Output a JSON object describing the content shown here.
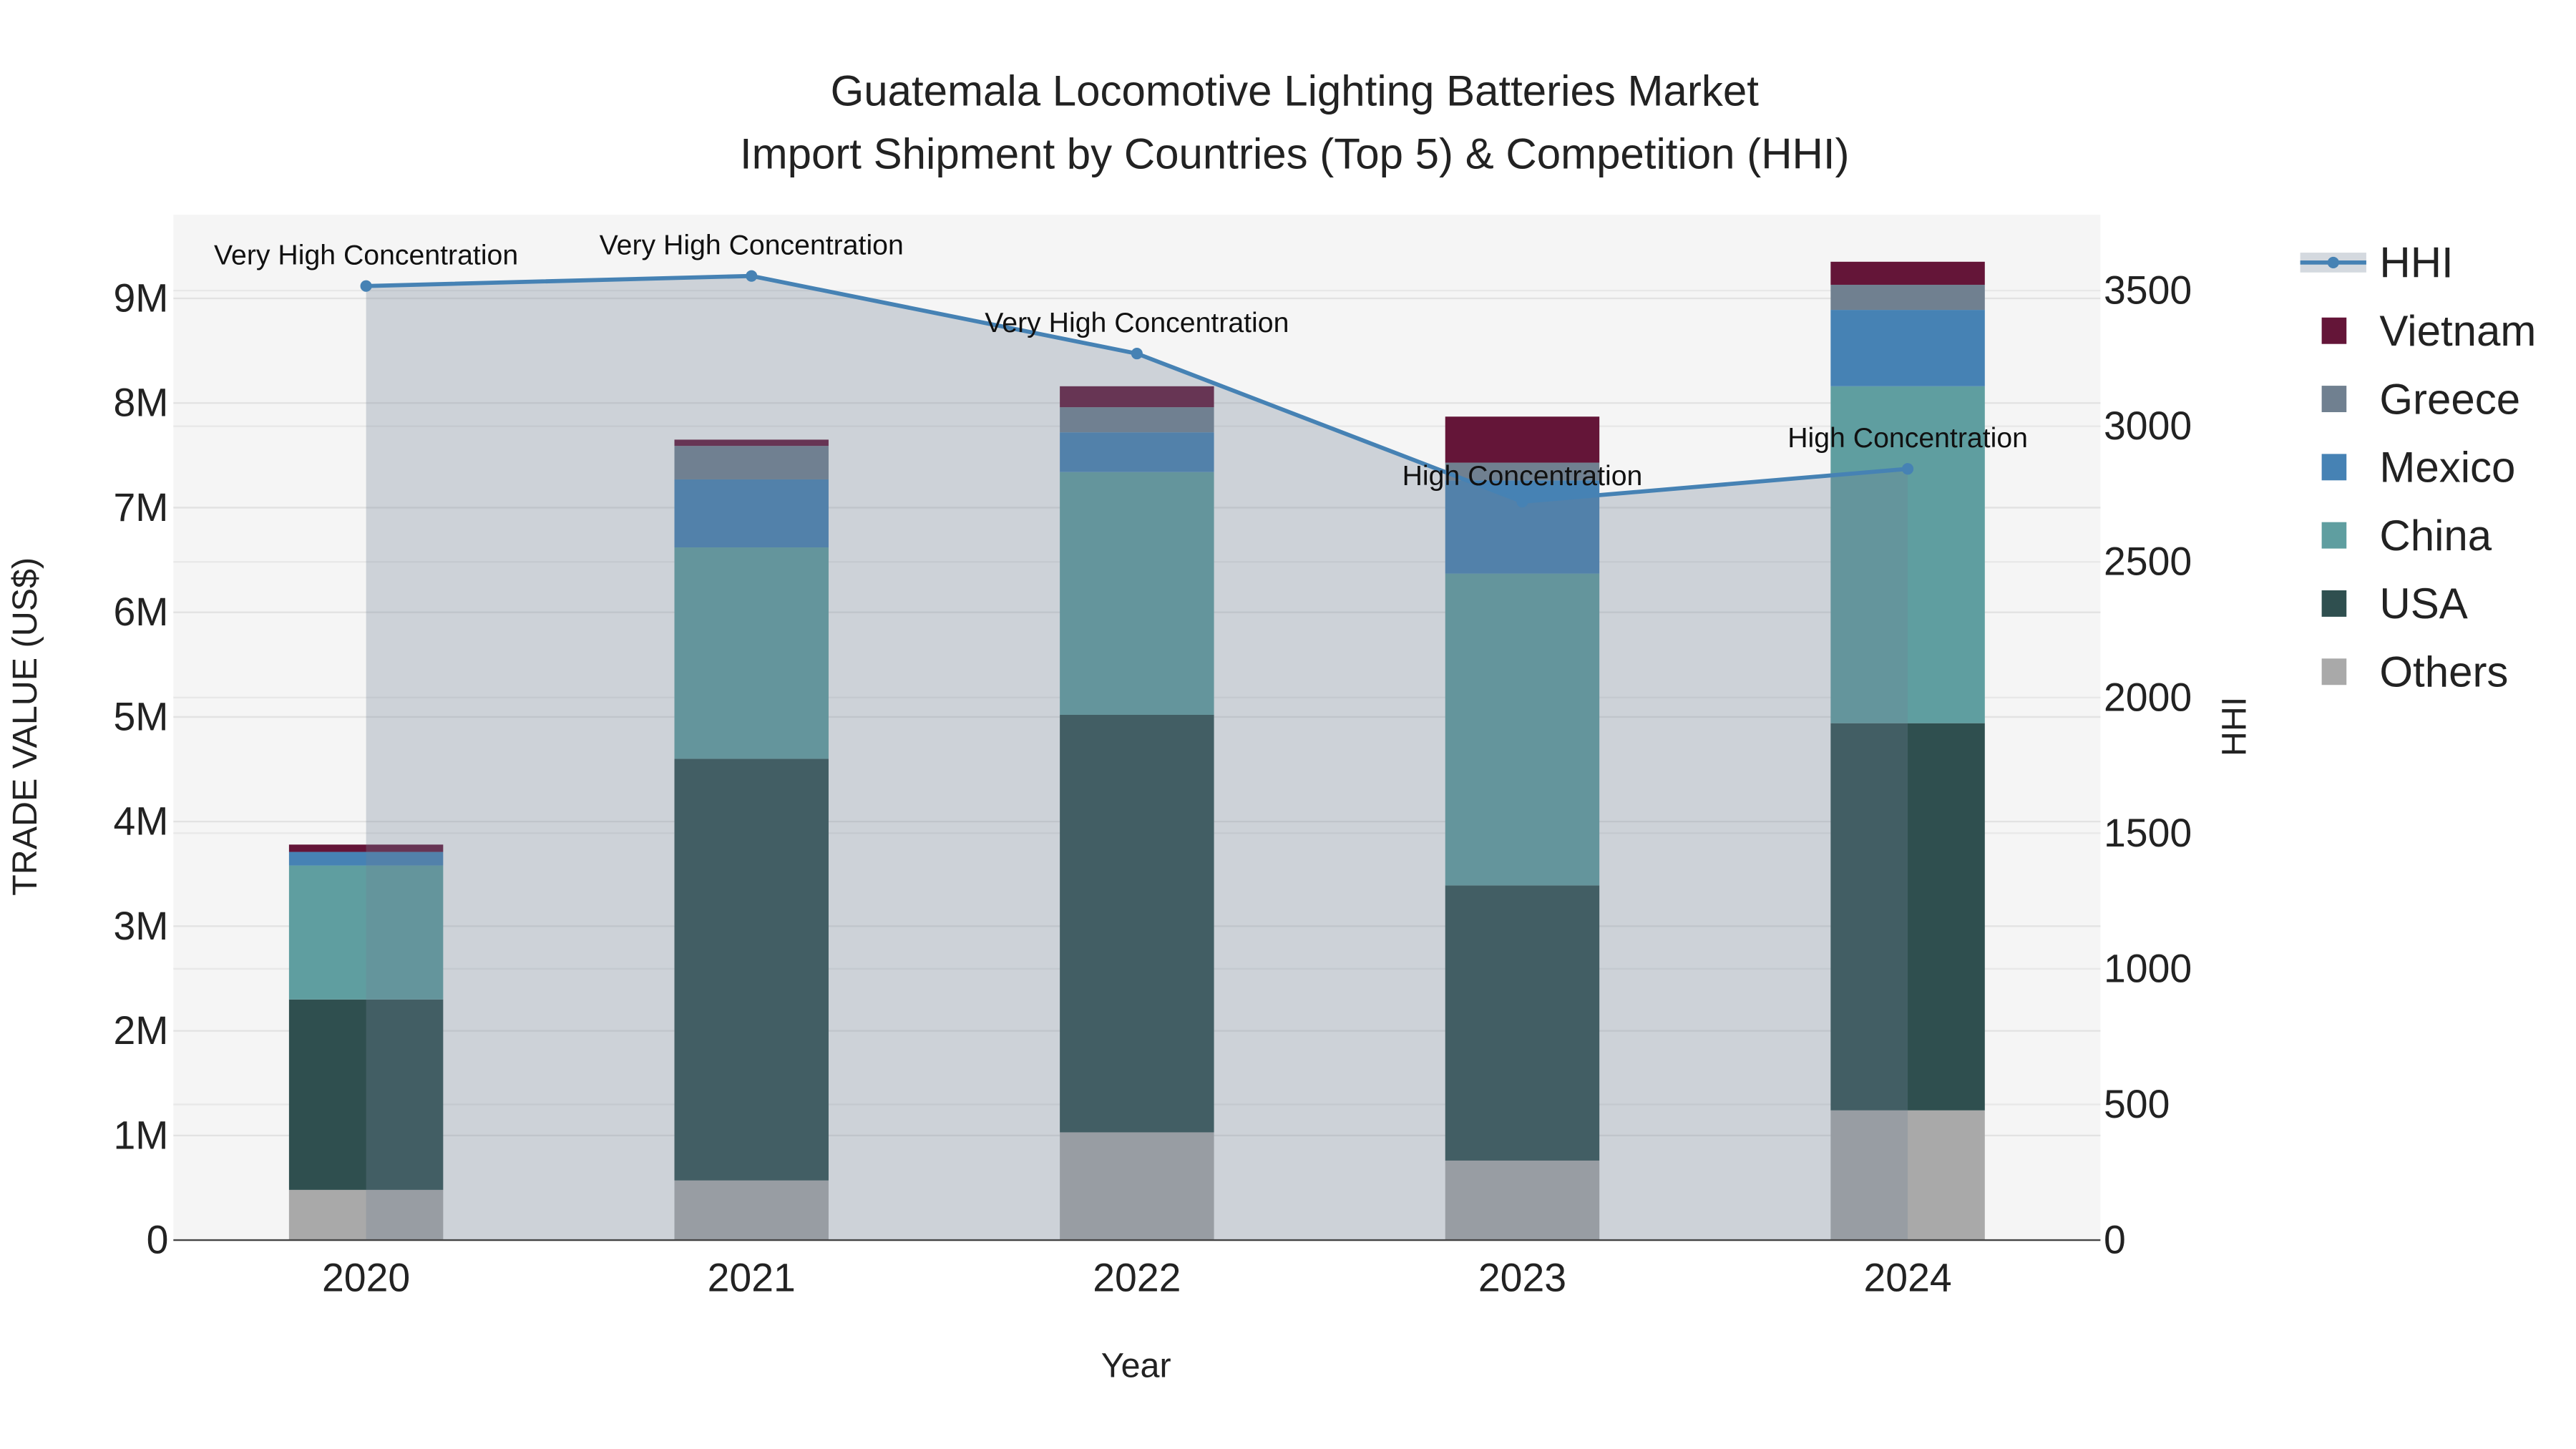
{
  "chart_data": {
    "type": "bar",
    "stacked": true,
    "title_line1": "Guatemala Locomotive Lighting Batteries Market",
    "title_line2": "Import Shipment by Countries (Top 5) & Competition (HHI)",
    "xlabel": "Year",
    "ylabel": "TRADE VALUE (US$)",
    "y2label": "HHI",
    "categories": [
      "2020",
      "2021",
      "2022",
      "2023",
      "2024"
    ],
    "ylim": [
      0,
      9800000
    ],
    "yticks": [
      0,
      1000000,
      2000000,
      3000000,
      4000000,
      5000000,
      6000000,
      7000000,
      8000000,
      9000000
    ],
    "ytick_labels": [
      "0",
      "1M",
      "2M",
      "3M",
      "4M",
      "5M",
      "6M",
      "7M",
      "8M",
      "9M"
    ],
    "y2lim": [
      0,
      3780
    ],
    "y2ticks": [
      0,
      500,
      1000,
      1500,
      2000,
      2500,
      3000,
      3500
    ],
    "y2tick_labels": [
      "0",
      "500",
      "1000",
      "1500",
      "2000",
      "2500",
      "3000",
      "3500"
    ],
    "grid": true,
    "legend_placement": "right",
    "series": [
      {
        "name": "Others",
        "color": "#A9A9A9",
        "values": [
          480000,
          570000,
          1030000,
          760000,
          1240000
        ]
      },
      {
        "name": "USA",
        "color": "#2F4F4F",
        "values": [
          1820000,
          4030000,
          3990000,
          2630000,
          3700000
        ]
      },
      {
        "name": "China",
        "color": "#5F9EA0",
        "values": [
          1280000,
          2020000,
          2320000,
          2980000,
          3220000
        ]
      },
      {
        "name": "Mexico",
        "color": "#4682B4",
        "values": [
          130000,
          650000,
          380000,
          890000,
          730000
        ]
      },
      {
        "name": "Greece",
        "color": "#708090",
        "values": [
          0,
          320000,
          240000,
          170000,
          240000
        ]
      },
      {
        "name": "Vietnam",
        "color": "#641538",
        "values": [
          70000,
          60000,
          200000,
          440000,
          220000
        ]
      }
    ],
    "hhi": {
      "name": "HHI",
      "color": "#4682B4",
      "values": [
        3517,
        3554,
        3268,
        2722,
        2843
      ],
      "annotations": [
        "Very High Concentration",
        "Very High Concentration",
        "Very High Concentration",
        "High Concentration",
        "High Concentration"
      ]
    },
    "legend_order": [
      "HHI",
      "Vietnam",
      "Greece",
      "Mexico",
      "China",
      "USA",
      "Others"
    ]
  }
}
